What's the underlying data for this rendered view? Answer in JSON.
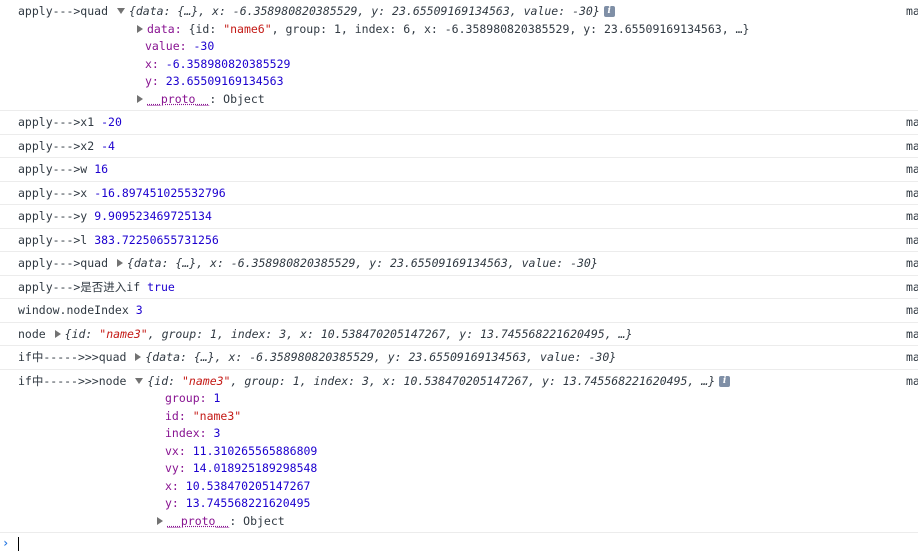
{
  "source_label": "ma",
  "quad_expanded": {
    "prefix": "apply--->quad",
    "preview": "{data: {…}, x: -6.358980820385529, y: 23.65509169134563, value: -30}",
    "info_badge": "i",
    "data_label": "data:",
    "data_preview_a": "{id: ",
    "data_id": "\"name6\"",
    "data_preview_b": ", group: 1, index: 6, x: -6.358980820385529, y: 23.65509169134563, …}",
    "value_key": "value:",
    "value_val": "-30",
    "x_key": "x:",
    "x_val": "-6.358980820385529",
    "y_key": "y:",
    "y_val": "23.65509169134563",
    "proto_key": "__proto__",
    "proto_val": ": Object"
  },
  "rows": {
    "x1_label": "apply--->x1",
    "x1_val": "-20",
    "x2_label": "apply--->x2",
    "x2_val": "-4",
    "w_label": "apply--->w",
    "w_val": "16",
    "x_label": "apply--->x",
    "x_val": "-16.897451025532796",
    "y_label": "apply--->y",
    "y_val": "9.909523469725134",
    "l_label": "apply--->l",
    "l_val": "383.72250655731256",
    "quad2_label": "apply--->quad",
    "quad2_preview": "{data: {…}, x: -6.358980820385529, y: 23.65509169134563, value: -30}",
    "if_label": "apply--->是否进入if",
    "if_val": "true",
    "ni_label": "window.nodeIndex",
    "ni_val": "3",
    "node_label": "node",
    "node_preview_a": "{id: ",
    "node_id": "\"name3\"",
    "node_preview_b": ", group: 1, index: 3, x: 10.538470205147267, y: 13.745568221620495, …}",
    "ifquad_label": "if中----->>>quad",
    "ifquad_preview": "{data: {…}, x: -6.358980820385529, y: 23.65509169134563, value: -30}"
  },
  "node_expanded": {
    "prefix": "if中----->>>node",
    "preview_a": "{id: ",
    "preview_id": "\"name3\"",
    "preview_b": ", group: 1, index: 3, x: 10.538470205147267, y: 13.745568221620495, …}",
    "info_badge": "i",
    "group_key": "group:",
    "group_val": "1",
    "id_key": "id:",
    "id_val": "\"name3\"",
    "index_key": "index:",
    "index_val": "3",
    "vx_key": "vx:",
    "vx_val": "11.310265565886809",
    "vy_key": "vy:",
    "vy_val": "14.018925189298548",
    "x_key": "x:",
    "x_val": "10.538470205147267",
    "y_key": "y:",
    "y_val": "13.745568221620495",
    "proto_key": "__proto__",
    "proto_val": ": Object"
  },
  "prompt": {
    "glyph": "›"
  }
}
